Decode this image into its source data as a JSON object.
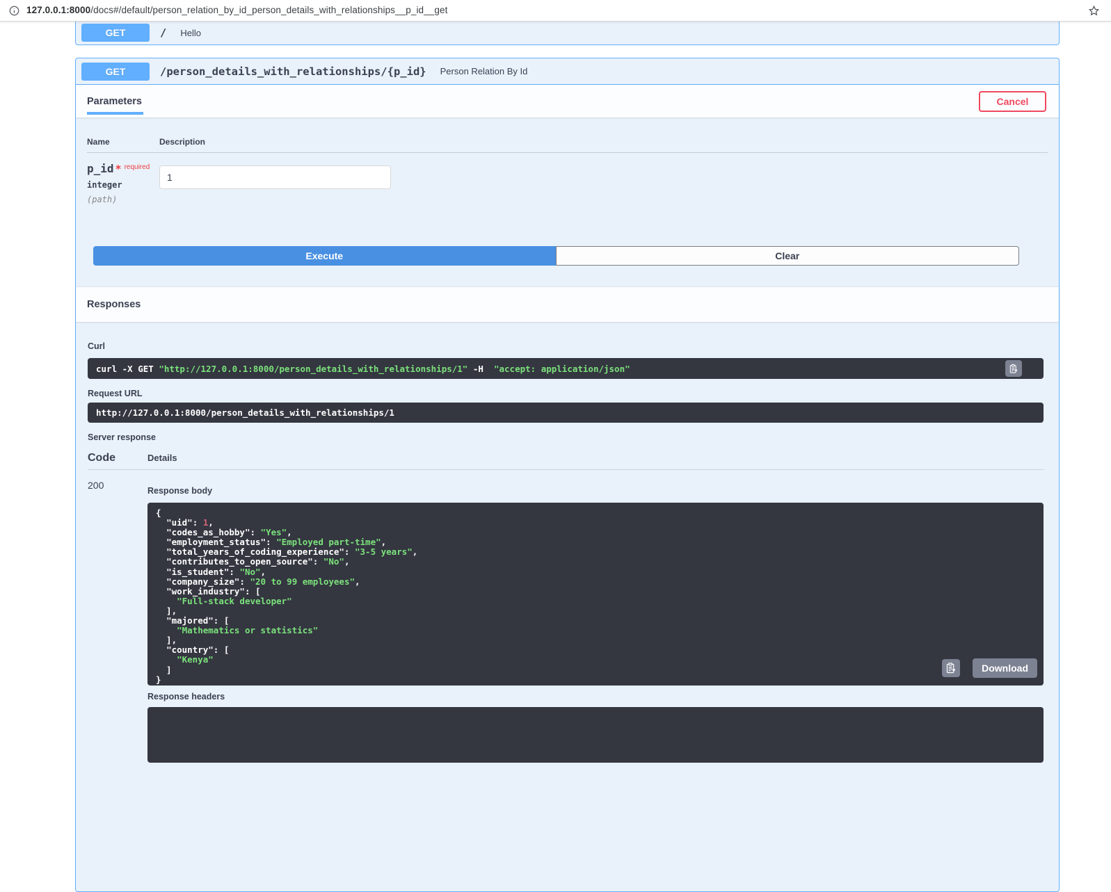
{
  "browser": {
    "host": "127.0.0.1:8000",
    "path": "/docs#/default/person_relation_by_id_person_details_with_relationships__p_id__get"
  },
  "hello_endpoint": {
    "method": "GET",
    "path": "/",
    "summary": "Hello"
  },
  "endpoint": {
    "method": "GET",
    "path": "/person_details_with_relationships/{p_id}",
    "summary": "Person Relation By Id",
    "parameters_tab": "Parameters",
    "cancel_button": "Cancel",
    "table": {
      "name_header": "Name",
      "description_header": "Description"
    },
    "param": {
      "name": "p_id",
      "required_star": "*",
      "required": "required",
      "type": "integer",
      "location": "(path)",
      "value": "1"
    },
    "execute_button": "Execute",
    "clear_button": "Clear",
    "responses": {
      "title": "Responses",
      "curl_label": "Curl",
      "curl_parts": [
        {
          "c": "plain",
          "t": "curl -X GET "
        },
        {
          "c": "string",
          "t": "\"http://127.0.0.1:8000/person_details_with_relationships/1\""
        },
        {
          "c": "plain",
          "t": " -H "
        },
        {
          "c": "string",
          "t": " \"accept: application/json\""
        }
      ],
      "request_url_label": "Request URL",
      "request_url": "http://127.0.0.1:8000/person_details_with_relationships/1",
      "server_response_label": "Server response",
      "code_header": "Code",
      "details_header": "Details",
      "status_code": "200",
      "response_body_label": "Response body",
      "body": {
        "uid": 1,
        "codes_as_hobby": "Yes",
        "employment_status": "Employed part-time",
        "total_years_of_coding_experience": "3-5 years",
        "contributes_to_open_source": "No",
        "is_student": "No",
        "company_size": "20 to 99 employees",
        "work_industry": [
          "Full-stack developer"
        ],
        "majored": [
          "Mathematics or statistics"
        ],
        "country": [
          "Kenya"
        ]
      },
      "download_button": "Download",
      "response_headers_label": "Response headers"
    }
  },
  "colors": {
    "accent_blue": "#61affe",
    "execute_blue": "#4990e2",
    "cancel_red": "#f0485e",
    "code_background": "#343640",
    "string_green": "#7be27b",
    "number_pink": "#d36377",
    "control_gray": "#7d8293"
  }
}
